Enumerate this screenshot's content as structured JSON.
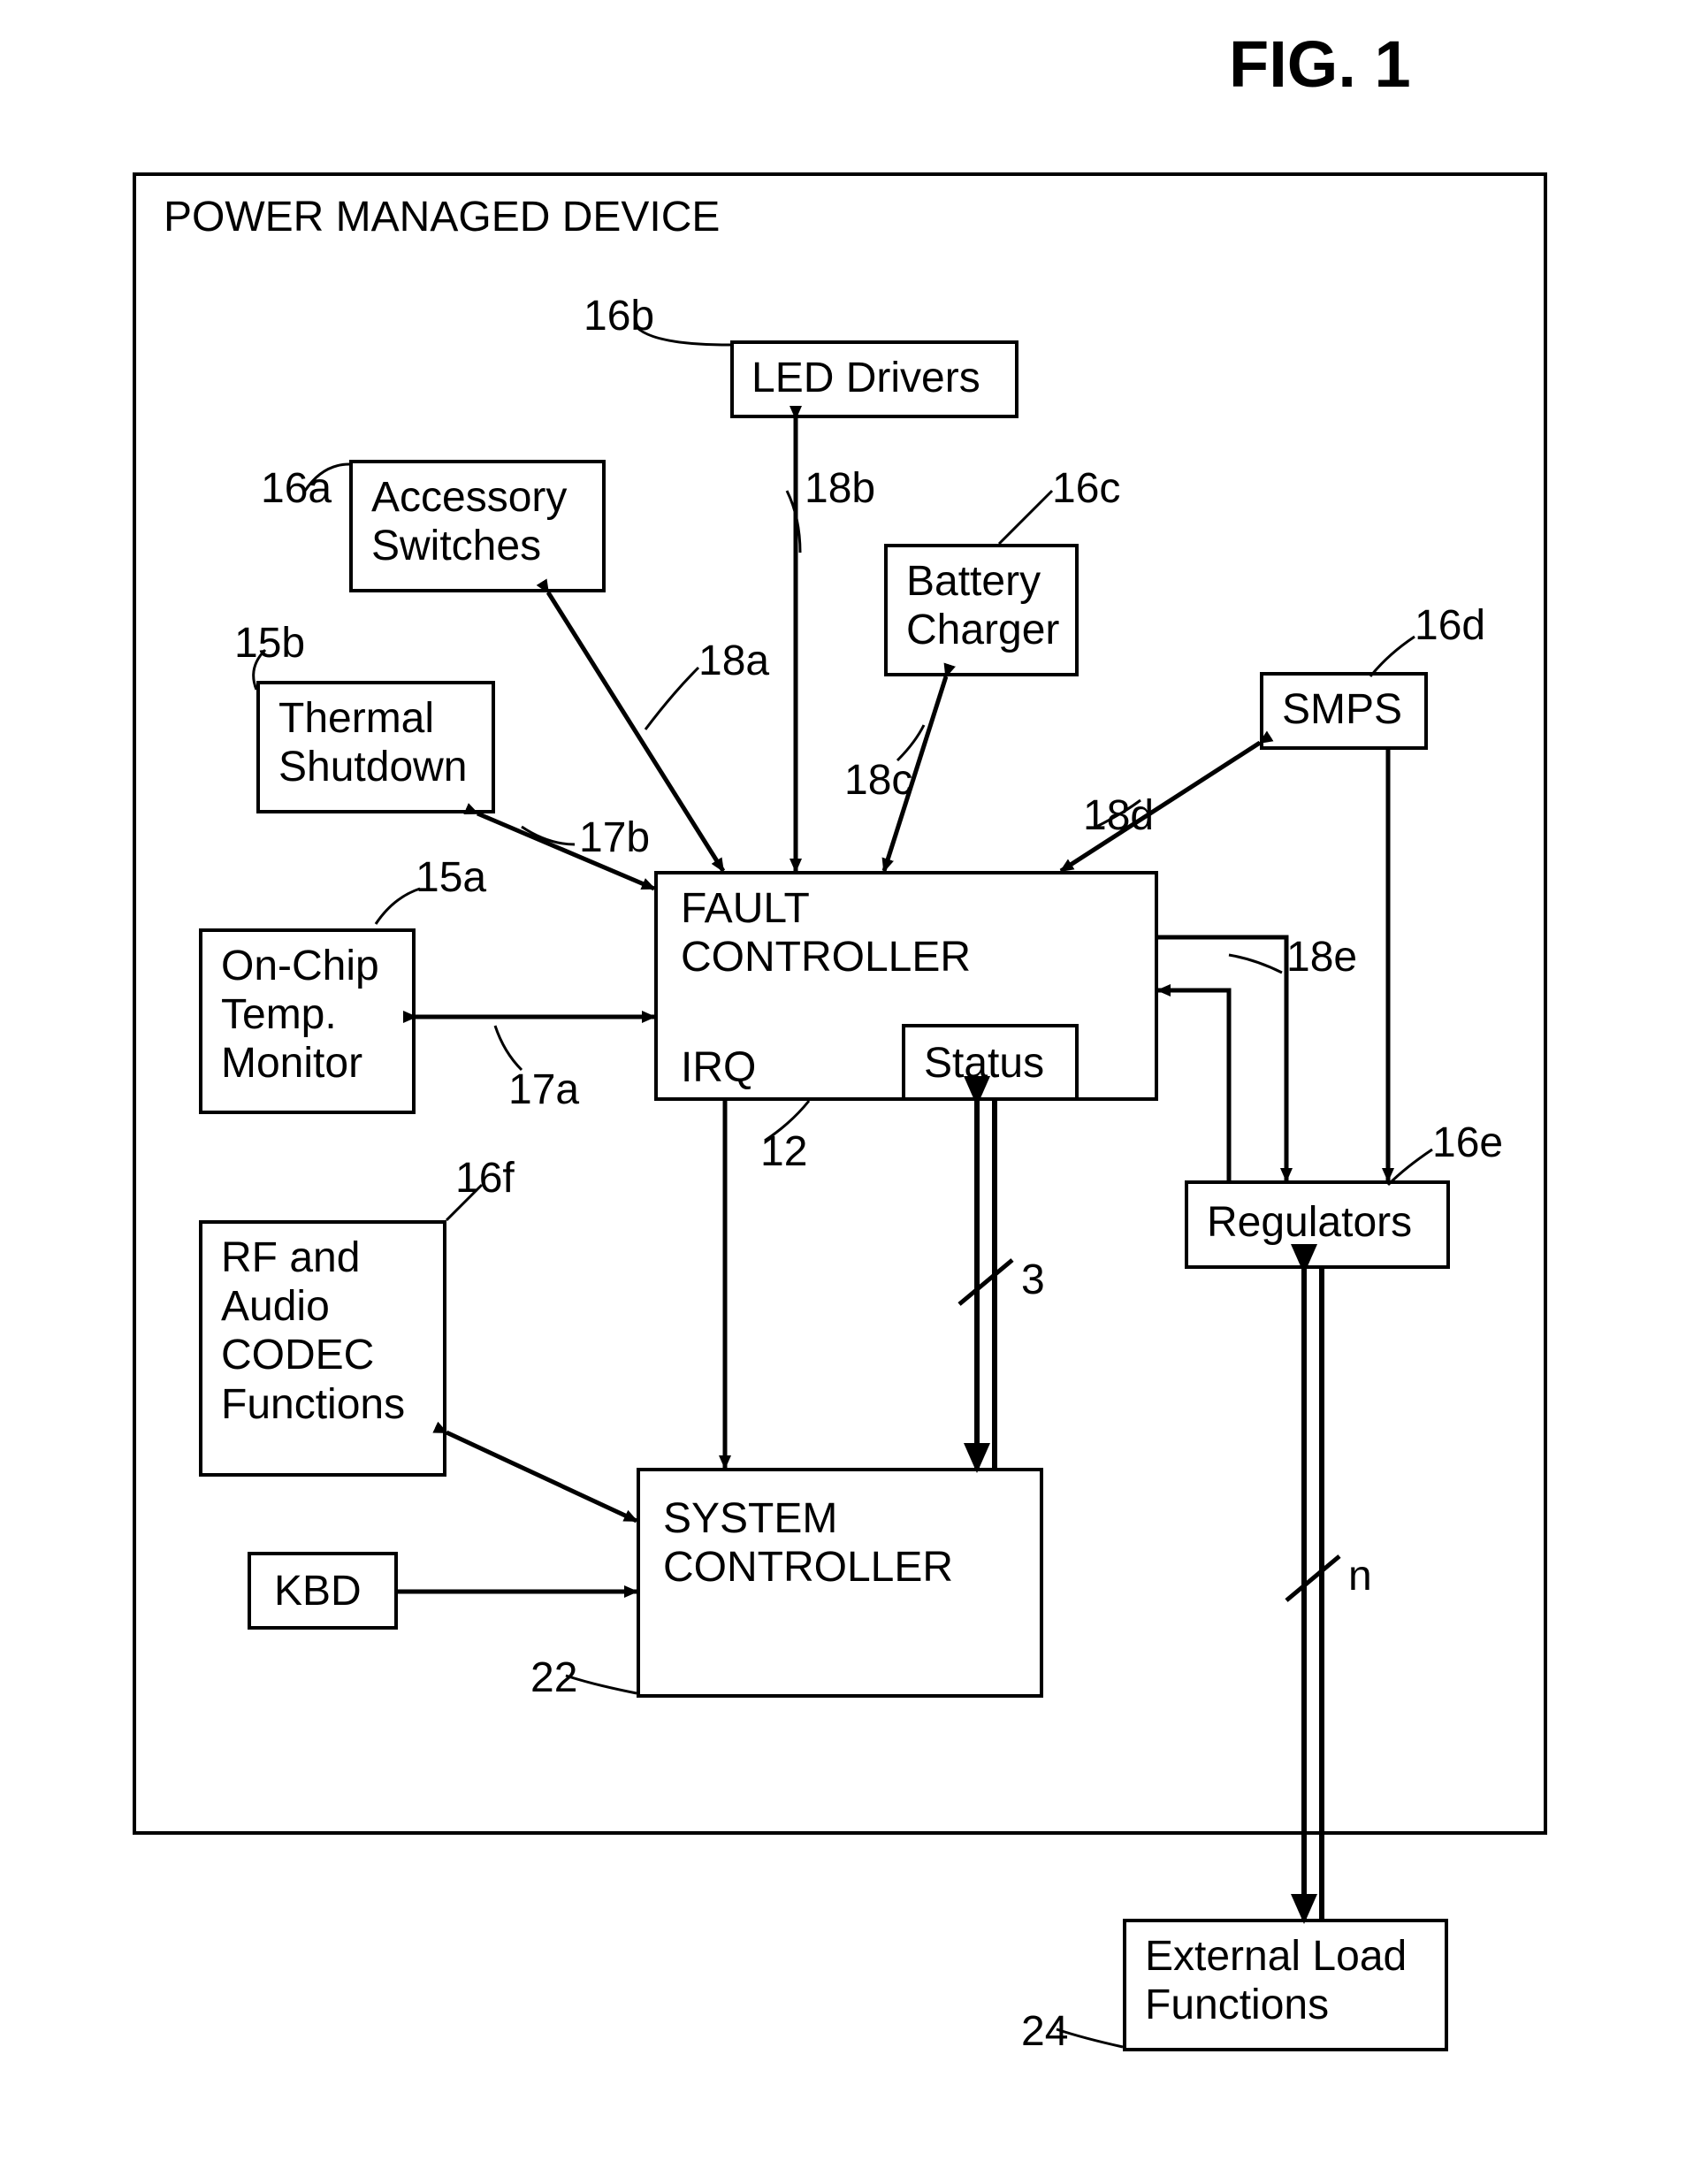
{
  "figure_label": "FIG. 1",
  "container_title": "POWER MANAGED DEVICE",
  "blocks": {
    "led_drivers": "LED Drivers",
    "accessory_switches": "Accessory\nSwitches",
    "battery_charger": "Battery\nCharger",
    "smps": "SMPS",
    "thermal_shutdown": "Thermal\nShutdown",
    "on_chip_temp": "On-Chip\nTemp.\nMonitor",
    "fault_controller": "FAULT\nCONTROLLER",
    "irq": "IRQ",
    "status": "Status",
    "regulators": "Regulators",
    "rf_audio": "RF and\nAudio\nCODEC\nFunctions",
    "system_controller": "SYSTEM\nCONTROLLER",
    "kbd": "KBD",
    "external_load": "External Load\nFunctions"
  },
  "refs": {
    "r16b": "16b",
    "r18b": "18b",
    "r16a": "16a",
    "r16c": "16c",
    "r15b": "15b",
    "r18a": "18a",
    "r18c": "18c",
    "r16d": "16d",
    "r18d": "18d",
    "r17b": "17b",
    "r15a": "15a",
    "r18e": "18e",
    "r17a": "17a",
    "r12": "12",
    "r16f": "16f",
    "r16e": "16e",
    "r22": "22",
    "r24": "24",
    "bus3": "3",
    "busn": "n"
  },
  "chart_data": {
    "type": "diagram",
    "title": "FIG. 1 — Power Managed Device block diagram",
    "nodes": [
      {
        "id": "container",
        "label": "POWER MANAGED DEVICE"
      },
      {
        "id": "led_drivers",
        "label": "LED Drivers",
        "ref": "16b"
      },
      {
        "id": "accessory_switches",
        "label": "Accessory Switches",
        "ref": "16a"
      },
      {
        "id": "battery_charger",
        "label": "Battery Charger",
        "ref": "16c"
      },
      {
        "id": "smps",
        "label": "SMPS",
        "ref": "16d"
      },
      {
        "id": "thermal_shutdown",
        "label": "Thermal Shutdown",
        "ref": "15b"
      },
      {
        "id": "on_chip_temp",
        "label": "On-Chip Temp. Monitor",
        "ref": "15a"
      },
      {
        "id": "fault_controller",
        "label": "FAULT CONTROLLER",
        "ref": "12",
        "sub": [
          "IRQ",
          "Status"
        ]
      },
      {
        "id": "regulators",
        "label": "Regulators",
        "ref": "16e"
      },
      {
        "id": "rf_audio",
        "label": "RF and Audio CODEC Functions",
        "ref": "16f"
      },
      {
        "id": "system_controller",
        "label": "SYSTEM CONTROLLER",
        "ref": "22"
      },
      {
        "id": "kbd",
        "label": "KBD"
      },
      {
        "id": "external_load",
        "label": "External Load Functions",
        "ref": "24"
      }
    ],
    "edges": [
      {
        "from": "led_drivers",
        "to": "fault_controller",
        "dir": "bi",
        "ref": "18b"
      },
      {
        "from": "accessory_switches",
        "to": "fault_controller",
        "dir": "bi",
        "ref": "18a"
      },
      {
        "from": "battery_charger",
        "to": "fault_controller",
        "dir": "bi",
        "ref": "18c"
      },
      {
        "from": "smps",
        "to": "fault_controller",
        "dir": "bi",
        "ref": "18d"
      },
      {
        "from": "thermal_shutdown",
        "to": "fault_controller",
        "dir": "bi",
        "ref": "17b"
      },
      {
        "from": "on_chip_temp",
        "to": "fault_controller",
        "dir": "bi",
        "ref": "17a"
      },
      {
        "from": "regulators",
        "to": "fault_controller",
        "dir": "uni",
        "ref": "18e"
      },
      {
        "from": "fault_controller",
        "to": "regulators",
        "dir": "uni"
      },
      {
        "from": "smps",
        "to": "regulators",
        "dir": "uni"
      },
      {
        "from": "fault_controller",
        "to": "system_controller",
        "dir": "uni",
        "via": "IRQ"
      },
      {
        "from": "fault_controller",
        "to": "system_controller",
        "dir": "bi",
        "via": "Status",
        "bus_width": "3"
      },
      {
        "from": "rf_audio",
        "to": "system_controller",
        "dir": "bi"
      },
      {
        "from": "kbd",
        "to": "system_controller",
        "dir": "uni"
      },
      {
        "from": "regulators",
        "to": "external_load",
        "dir": "bi",
        "bus_width": "n"
      }
    ]
  }
}
